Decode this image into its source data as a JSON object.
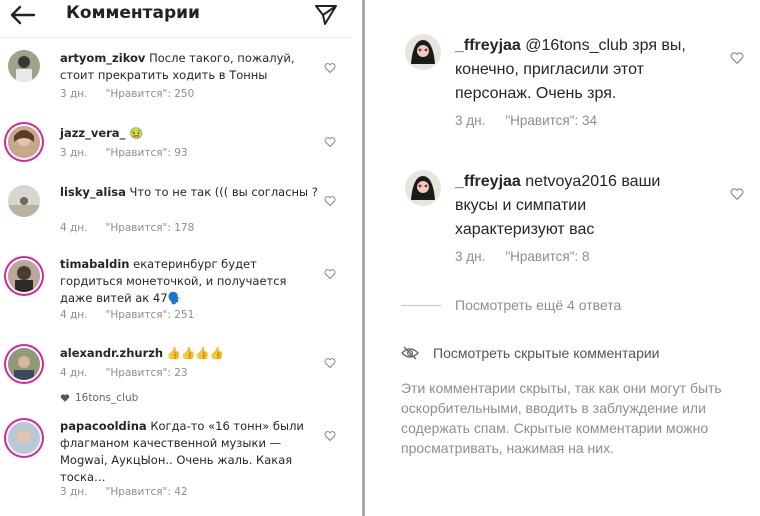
{
  "header": {
    "title": "Комментарии"
  },
  "left_comments": [
    {
      "username": "artyom_zikov",
      "text": "После такого, пожалуй, стоит прекратить ходить в Тонны",
      "time": "3 дн.",
      "likes": "\"Нравится\": 250"
    },
    {
      "username": "jazz_vera_",
      "text": "🤢",
      "time": "3 дн.",
      "likes": "\"Нравится\": 93"
    },
    {
      "username": "lisky_alisa",
      "text": "Что то не так ((( вы согласны ?",
      "time": "4 дн.",
      "likes": "\"Нравится\": 178"
    },
    {
      "username": "timabaldin",
      "text": "екатеринбург будет гордиться монеточкой, и получается даже витей ак 47🗣️",
      "time": "4 дн.",
      "likes": "\"Нравится\": 251"
    },
    {
      "username": "alexandr.zhurzh",
      "text": "👍👍👍👍",
      "time": "4 дн.",
      "likes": "\"Нравится\": 23"
    },
    {
      "username": "papacooldina",
      "text": "Когда-то «16 тонн» были флагманом качественной музыки — Mogwai, АукцЫон.. Очень жаль. Какая тоска…",
      "time": "3 дн.",
      "likes": "\"Нравится\": 42"
    }
  ],
  "liked_by": "16tons_club",
  "right_comments": [
    {
      "username": "_ffreyjaa",
      "text": "@16tons_club зря вы, конечно, пригласили этот персонаж. Очень зря.",
      "time": "3 дн.",
      "likes": "\"Нравится\": 34"
    },
    {
      "username": "_ffreyjaa",
      "text": "netvoya2016 ваши вкусы и симпатии характеризуют вас",
      "time": "3 дн.",
      "likes": "\"Нравится\": 8"
    }
  ],
  "more_replies": "Посмотреть ещё 4 ответа",
  "hidden_comments_link": "Посмотреть скрытые комментарии",
  "hidden_comments_note": "Эти комментарии скрыты, так как они могут быть оскорбительными, вводить в заблуждение или содержать спам. Скрытые комментарии можно просматривать, нажимая на них.",
  "icons": [
    "back-arrow-icon",
    "send-icon",
    "heart-icon",
    "eye-slash-icon"
  ],
  "colors": {
    "text": "#262626",
    "muted": "#8e8e8e",
    "story_ring": "#d6249f"
  }
}
